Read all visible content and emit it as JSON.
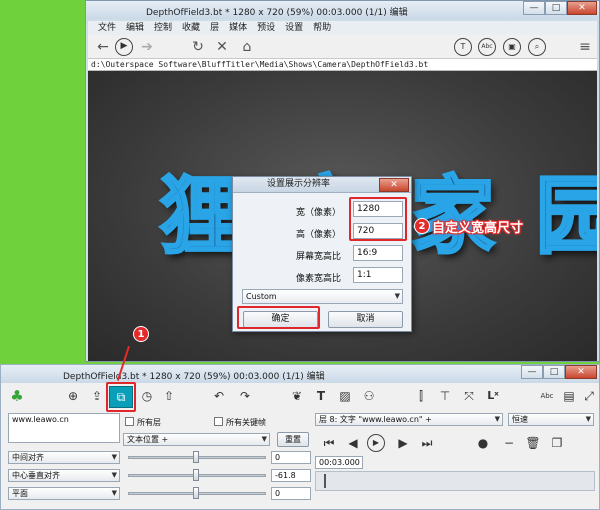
{
  "top_window": {
    "title": "DepthOfField3.bt * 1280 x 720 (59%) 00:03.000 (1/1) 编辑",
    "menu": [
      "文件",
      "编辑",
      "控制",
      "收藏",
      "层",
      "媒体",
      "预设",
      "设置",
      "帮助"
    ],
    "path": "d:\\Outerspace Software\\BluffTitler\\Media\\Shows\\Camera\\DepthOfField3.bt",
    "toolbar_round_icons": [
      "T",
      "Abc",
      "img",
      "cam"
    ],
    "caption": {
      "min": "—",
      "max": "□",
      "close": "✕"
    }
  },
  "canvas_text": "狸 窝 家 园",
  "dialog": {
    "title": "设置展示分辨率",
    "close": "✕",
    "width_label": "宽（像素）",
    "width_value": "1280",
    "height_label": "高（像素）",
    "height_value": "720",
    "aspect_label": "屏幕宽高比",
    "aspect_value": "16:9",
    "pixel_aspect_label": "像素宽高比",
    "pixel_aspect_value": "1:1",
    "preset_value": "Custom",
    "ok_label": "确定",
    "cancel_label": "取消"
  },
  "annotations": {
    "badge1": "1",
    "badge2": "2",
    "note2": "自定义宽高尺寸"
  },
  "bottom_window": {
    "title": "DepthOfField3.bt * 1280 x 720 (59%) 00:03.000 (1/1) 编辑",
    "caption": {
      "min": "—",
      "max": "□",
      "close": "✕"
    },
    "text_value": "www.leawo.cn",
    "all_layers_label": "所有层",
    "all_keyframes_label": "所有关键帧",
    "text_position_select": "文本位置 +",
    "reset_button": "重置",
    "align_h": "中间对齐",
    "align_v": "中心垂直对齐",
    "plane": "平面",
    "value1": "0",
    "value2": "-61.8",
    "value3": "0",
    "layer_select": "层 8: 文字 \"www.leawo.cn\" +",
    "speed_select": "恒速",
    "time_value": "00:03.000"
  },
  "colors": {
    "accent_red": "#e32b2b",
    "highlight_teal": "#0a9fb8",
    "text_blue": "#29a4e6"
  }
}
